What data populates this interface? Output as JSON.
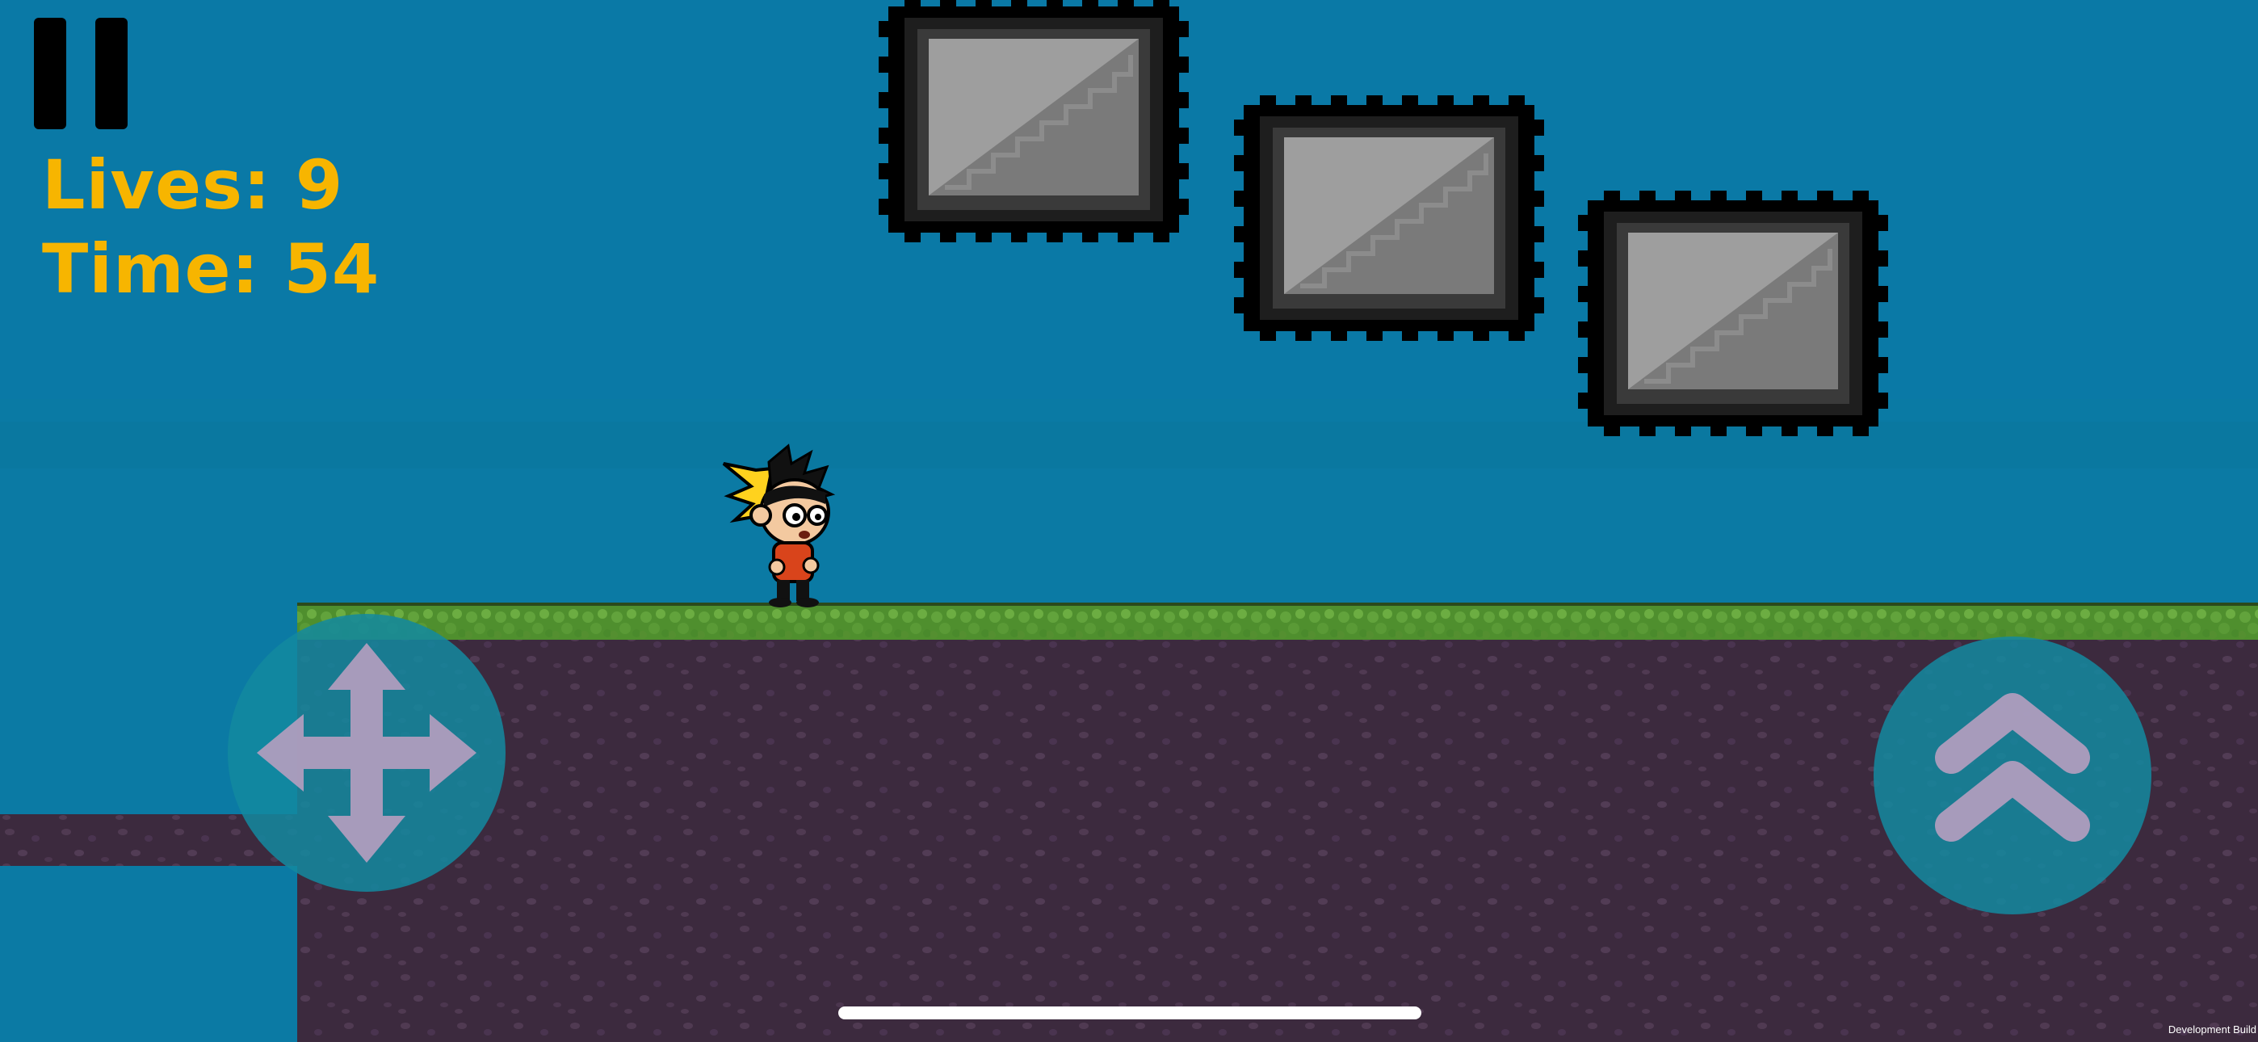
{
  "hud": {
    "lives_label": "Lives: 9",
    "time_label": "Time: 54"
  },
  "controls": {
    "pause_icon": "pause-icon",
    "move_icon": "four-way-arrow-icon",
    "jump_icon": "double-chevron-up-icon"
  },
  "footer": {
    "build_label": "Development Build"
  },
  "colors": {
    "sky": "#0a79a6",
    "hud_text": "#f7b500",
    "ground": "#3c2a3e",
    "grass": "#62a33c",
    "control_bg": "#138aa0",
    "control_icon": "#b79fc0"
  }
}
